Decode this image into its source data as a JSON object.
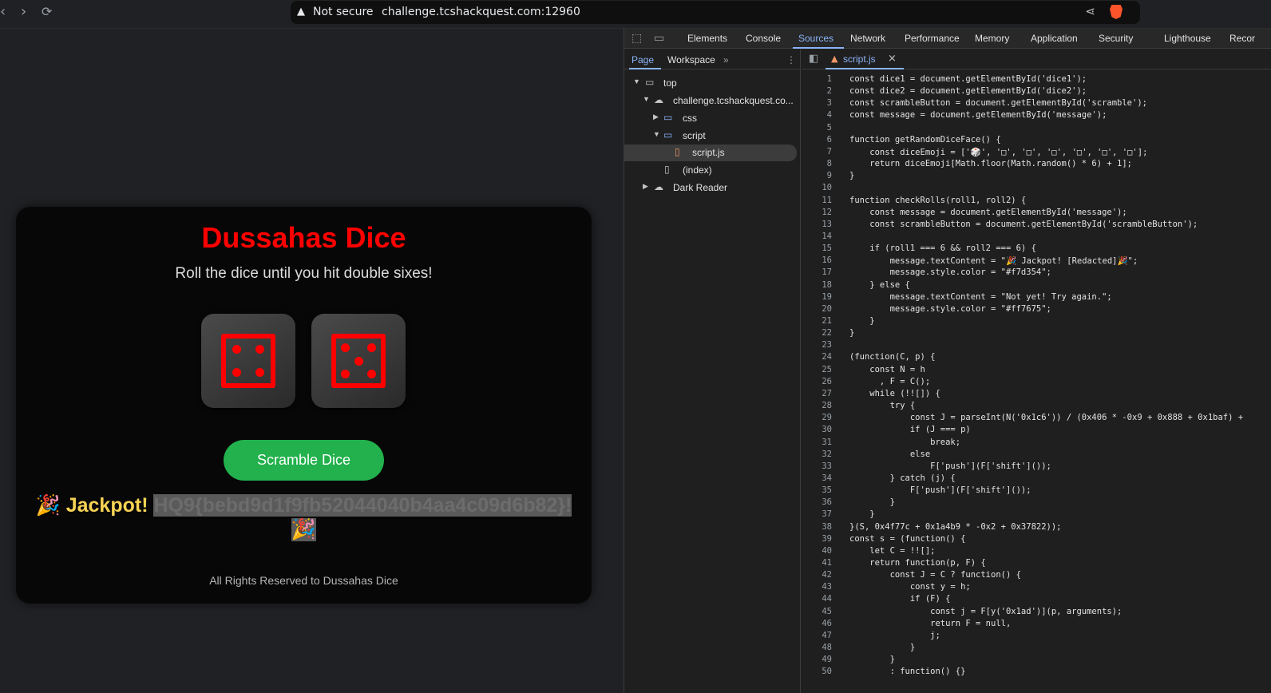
{
  "browser": {
    "security_label": "Not secure",
    "url": "challenge.tcshackquest.com:12960"
  },
  "page": {
    "title": "Dussahas Dice",
    "subtitle": "Roll the dice until you hit double sixes!",
    "dice": [
      4,
      5
    ],
    "button_label": "Scramble Dice",
    "message_prefix": "🎉 Jackpot! ",
    "message_flag": "HQ9{bebd9d1f9fb52044040b4aa4c09d6b82}!",
    "message_suffix": "🎉",
    "footer": "All Rights Reserved to Dussahas Dice",
    "colors": {
      "title": "#ff0000",
      "button": "#22b14c",
      "message": "#f7d354"
    }
  },
  "devtools": {
    "tabs": [
      "Elements",
      "Console",
      "Sources",
      "Network",
      "Performance",
      "Memory",
      "Application",
      "Security",
      "Lighthouse",
      "Recor"
    ],
    "active_tab": "Sources",
    "navigator_tabs": [
      "Page",
      "Workspace"
    ],
    "tree": [
      "top",
      "challenge.tcshackquest.co...",
      "css",
      "script",
      "script.js",
      "(index)",
      "Dark Reader"
    ],
    "open_file": "script.js",
    "code_lines": [
      "const dice1 = document.getElementById('dice1');",
      "const dice2 = document.getElementById('dice2');",
      "const scrambleButton = document.getElementById('scramble');",
      "const message = document.getElementById('message');",
      "",
      "function getRandomDiceFace() {",
      "    const diceEmoji = ['🎲', '\u0000', '\u0000', '\u0000', '\u0000', '\u0000', '\u0000'];",
      "    return diceEmoji[Math.floor(Math.random() * 6) + 1];",
      "}",
      "",
      "function checkRolls(roll1, roll2) {",
      "    const message = document.getElementById('message');",
      "    const scrambleButton = document.getElementById('scrambleButton');",
      "",
      "    if (roll1 === 6 && roll2 === 6) {",
      "        message.textContent = \"🎉 Jackpot! [Redacted]🎉\";",
      "        message.style.color = \"#f7d354\";",
      "    } else {",
      "        message.textContent = \"Not yet! Try again.\";",
      "        message.style.color = \"#ff7675\";",
      "    }",
      "}",
      "",
      "(function(C, p) {",
      "    const N = h",
      "      , F = C();",
      "    while (!![]) {",
      "        try {",
      "            const J = parseInt(N('0x1c6')) / (0x406 * -0x9 + 0x888 + 0x1baf) +",
      "            if (J === p)",
      "                break;",
      "            else",
      "                F['push'](F['shift']());",
      "        } catch (j) {",
      "            F['push'](F['shift']());",
      "        }",
      "    }",
      "}(S, 0x4f77c + 0x1a4b9 * -0x2 + 0x37822));",
      "const s = (function() {",
      "    let C = !![];",
      "    return function(p, F) {",
      "        const J = C ? function() {",
      "            const y = h;",
      "            if (F) {",
      "                const j = F[y('0x1ad')](p, arguments);",
      "                return F = null,",
      "                j;",
      "            }",
      "        }",
      "        : function() {}"
    ]
  }
}
